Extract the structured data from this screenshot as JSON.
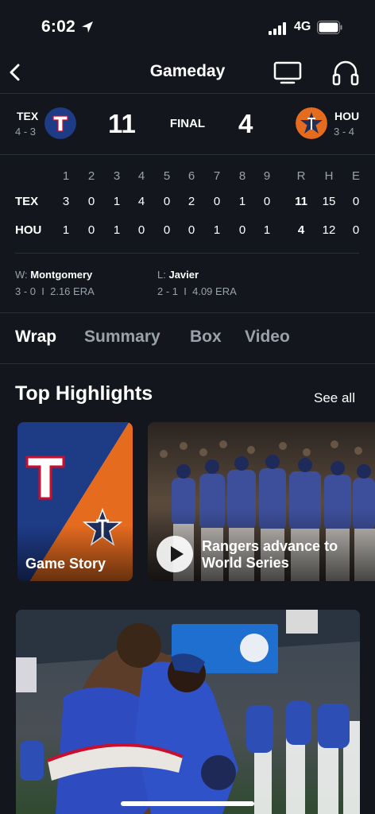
{
  "status_bar": {
    "time": "6:02",
    "network": "4G"
  },
  "nav": {
    "title": "Gameday"
  },
  "game": {
    "away": {
      "abbr": "TEX",
      "record": "4 - 3",
      "score": "11"
    },
    "home": {
      "abbr": "HOU",
      "record": "3 - 4",
      "score": "4"
    },
    "status": "FINAL"
  },
  "linescore": {
    "headers": [
      "1",
      "2",
      "3",
      "4",
      "5",
      "6",
      "7",
      "8",
      "9",
      "R",
      "H",
      "E"
    ],
    "rows": [
      {
        "team": "TEX",
        "values": [
          "3",
          "0",
          "1",
          "4",
          "0",
          "2",
          "0",
          "1",
          "0",
          "11",
          "15",
          "0"
        ]
      },
      {
        "team": "HOU",
        "values": [
          "1",
          "0",
          "1",
          "0",
          "0",
          "0",
          "1",
          "0",
          "1",
          "4",
          "12",
          "0"
        ]
      }
    ]
  },
  "pitchers": {
    "win": {
      "prefix": "W:",
      "name": "Montgomery",
      "record": "3 - 0",
      "sep": "I",
      "era": "2.16 ERA"
    },
    "loss": {
      "prefix": "L:",
      "name": "Javier",
      "record": "2 - 1",
      "sep": "I",
      "era": "4.09 ERA"
    }
  },
  "tabs": [
    "Wrap",
    "Summary",
    "Box",
    "Video"
  ],
  "highlights": {
    "title": "Top Highlights",
    "see_all": "See all",
    "cards": [
      {
        "label": "Game Story"
      },
      {
        "label_line1": "Rangers advance to",
        "label_line2": "World Series"
      }
    ]
  },
  "colors": {
    "background": "#13171d",
    "tex_blue": "#1e3b86",
    "hou_orange": "#e56b1f",
    "muted": "#9aa1aa"
  }
}
